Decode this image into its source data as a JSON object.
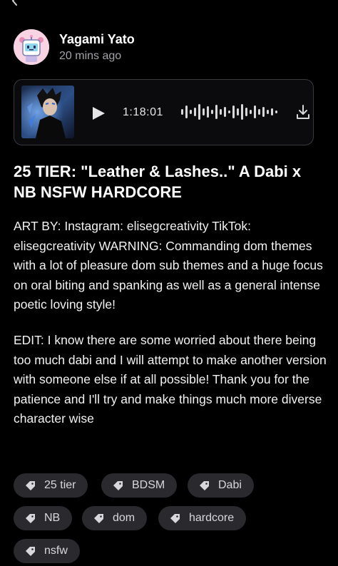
{
  "post": {
    "author": "Yagami Yato",
    "time": "20 mins ago",
    "audio": {
      "duration": "1:18:01"
    },
    "title": "25 TIER: \"Leather & Lashes..\" A Dabi x NB NSFW HARDCORE",
    "paragraphs": [
      "ART BY: Instagram: elisegcreativity TikTok: elisegcreativity WARNING: Commanding dom themes with a lot of pleasure dom sub themes and a huge focus on oral biting and spanking as well as a general intense poetic loving style!",
      "EDIT: I know there are some worried about there being too much dabi and I will attempt to make another version with someone else if at all possible! Thank you for the patience and I'll try and make things much more diverse character wise"
    ],
    "tags": [
      "25 tier",
      "BDSM",
      "Dabi",
      "NB",
      "dom",
      "hardcore",
      "nsfw"
    ]
  },
  "icons": {
    "back": "chevron-left-icon",
    "play": "play-icon",
    "waveform": "waveform-icon",
    "download": "download-icon",
    "tag": "tag-icon"
  },
  "colors": {
    "background": "#000000",
    "card_border": "#3a3a3e",
    "tag_bg": "#2a2a2e",
    "secondary_text": "#a3a3a8"
  }
}
